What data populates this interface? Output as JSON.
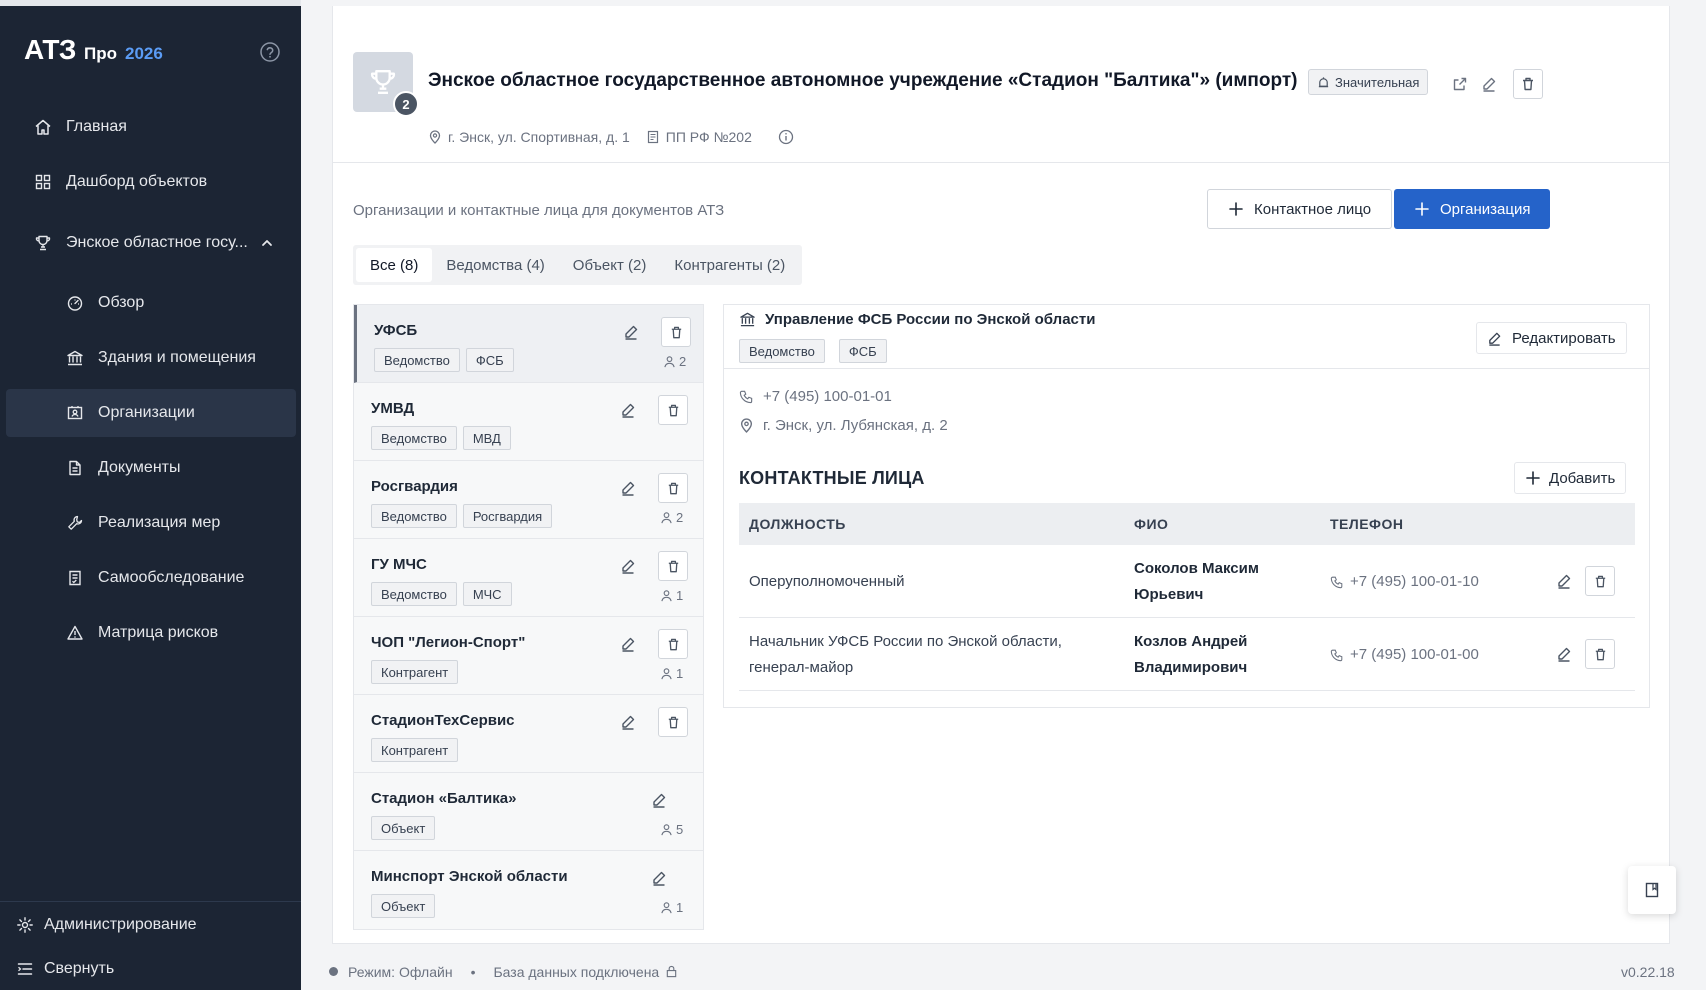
{
  "app": {
    "logo": "АТЗ",
    "edition": "Про",
    "year": "2026"
  },
  "sidebar": {
    "nav": [
      {
        "label": "Главная",
        "icon": "home-icon"
      },
      {
        "label": "Дашборд объектов",
        "icon": "grid-icon"
      },
      {
        "label": "Энское областное госу...",
        "icon": "trophy-icon",
        "expanded": true
      }
    ],
    "subnav": [
      {
        "label": "Обзор",
        "icon": "gauge-icon"
      },
      {
        "label": "Здания и помещения",
        "icon": "bank-icon"
      },
      {
        "label": "Организации",
        "icon": "id-card-icon",
        "active": true
      },
      {
        "label": "Документы",
        "icon": "document-icon"
      },
      {
        "label": "Реализация мер",
        "icon": "wrench-icon"
      },
      {
        "label": "Самообследование",
        "icon": "checklist-icon"
      },
      {
        "label": "Матрица рисков",
        "icon": "warning-icon"
      }
    ],
    "admin_label": "Администрирование",
    "collapse_label": "Свернуть"
  },
  "object": {
    "badge_count": "2",
    "title": "Энское областное государственное автономное учреждение «Стадион \"Балтика\"» (импорт)",
    "level": "Значительная",
    "address": "г. Энск, ул. Спортивная, д. 1",
    "regulation": "ПП РФ №202"
  },
  "section": {
    "label": "Организации и контактные лица для документов АТЗ",
    "add_contact": "Контактное лицо",
    "add_org": "Организация"
  },
  "tabs": [
    {
      "label": "Все (8)",
      "active": true
    },
    {
      "label": "Ведомства (4)"
    },
    {
      "label": "Объект (2)"
    },
    {
      "label": "Контрагенты (2)"
    }
  ],
  "orgs": [
    {
      "name": "УФСБ",
      "tags": [
        "Ведомство",
        "ФСБ"
      ],
      "count": "2",
      "deletable": true,
      "selected": true
    },
    {
      "name": "УМВД",
      "tags": [
        "Ведомство",
        "МВД"
      ],
      "count": "",
      "deletable": true
    },
    {
      "name": "Росгвардия",
      "tags": [
        "Ведомство",
        "Росгвардия"
      ],
      "count": "2",
      "deletable": true
    },
    {
      "name": "ГУ МЧС",
      "tags": [
        "Ведомство",
        "МЧС"
      ],
      "count": "1",
      "deletable": true
    },
    {
      "name": "ЧОП \"Легион-Спорт\"",
      "tags": [
        "Контрагент"
      ],
      "count": "1",
      "deletable": true
    },
    {
      "name": "СтадионТехСервис",
      "tags": [
        "Контрагент"
      ],
      "count": "",
      "deletable": true
    },
    {
      "name": "Стадион «Балтика»",
      "tags": [
        "Объект"
      ],
      "count": "5",
      "deletable": false
    },
    {
      "name": "Минспорт Энской области",
      "tags": [
        "Объект"
      ],
      "count": "1",
      "deletable": false
    }
  ],
  "detail": {
    "title": "Управление ФСБ России по Энской области",
    "tags": [
      "Ведомство",
      "ФСБ"
    ],
    "edit_label": "Редактировать",
    "phone": "+7 (495) 100-01-01",
    "address": "г. Энск, ул. Лубянская, д. 2",
    "contacts_title": "КОНТАКТНЫЕ ЛИЦА",
    "add_label": "Добавить",
    "columns": [
      "ДОЛЖНОСТЬ",
      "ФИО",
      "ТЕЛЕФОН"
    ],
    "contacts": [
      {
        "position": "Оперуполномоченный",
        "fio": "Соколов Максим Юрьевич",
        "phone": "+7 (495) 100-01-10"
      },
      {
        "position": "Начальник УФСБ России по Энской области, генерал-майор",
        "fio": "Козлов Андрей Владимирович",
        "phone": "+7 (495) 100-01-00"
      }
    ]
  },
  "status": {
    "mode": "Режим: Офлайн",
    "db": "База данных подключена",
    "version": "v0.22.18"
  }
}
